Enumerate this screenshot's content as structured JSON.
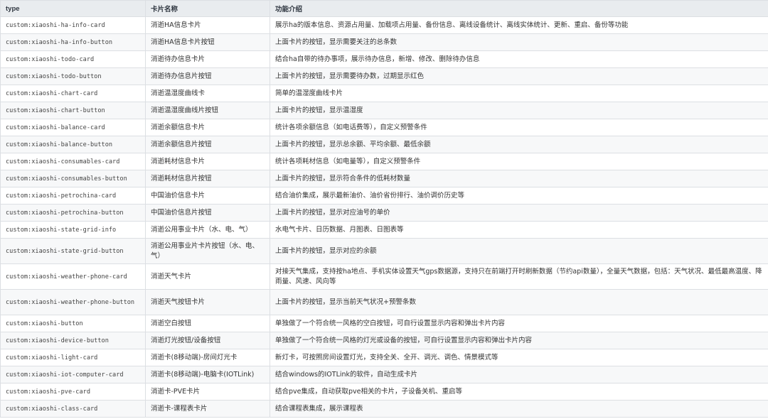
{
  "table": {
    "headers": [
      "type",
      "卡片名称",
      "功能介绍"
    ],
    "rows": [
      {
        "type": "custom:xiaoshi-ha-info-card",
        "name": "消逝HA信息卡片",
        "desc": "展示ha的版本信息、资源占用量、加载项占用量、备份信息、离线设备统计、离线实体统计、更新、重启、备份等功能"
      },
      {
        "type": "custom:xiaoshi-ha-info-button",
        "name": "消逝HA信息卡片按钮",
        "desc": "上面卡片的按钮，显示需要关注的总条数"
      },
      {
        "type": "custom:xiaoshi-todo-card",
        "name": "消逝待办信息卡片",
        "desc": "结合ha自带的待办事项，展示待办信息，新增、修改、删除待办信息"
      },
      {
        "type": "custom:xiaoshi-todo-button",
        "name": "消逝待办信息片按钮",
        "desc": "上面卡片的按钮，显示需要待办数，过期显示红色"
      },
      {
        "type": "custom:xiaoshi-chart-card",
        "name": "消逝温湿度曲线卡",
        "desc": "简单的温湿度曲线卡片"
      },
      {
        "type": "custom:xiaoshi-chart-button",
        "name": "消逝温湿度曲线片按钮",
        "desc": "上面卡片的按钮，显示温湿度"
      },
      {
        "type": "custom:xiaoshi-balance-card",
        "name": "消逝余额信息卡片",
        "desc": "统计各项余额信息（如电话费等），自定义预警条件"
      },
      {
        "type": "custom:xiaoshi-balance-button",
        "name": "消逝余额信息片按钮",
        "desc": "上面卡片的按钮，显示总余额、平均余额、最低余额"
      },
      {
        "type": "custom:xiaoshi-consumables-card",
        "name": "消逝耗材信息卡片",
        "desc": "统计各项耗材信息（如电量等），自定义预警条件"
      },
      {
        "type": "custom:xiaoshi-consumables-button",
        "name": "消逝耗材信息片按钮",
        "desc": "上面卡片的按钮，显示符合条件的低耗材数量"
      },
      {
        "type": "custom:xiaoshi-petrochina-card",
        "name": "中国油价信息卡片",
        "desc": "结合油价集成，展示最新油价、油价省份排行、油价调价历史等"
      },
      {
        "type": "custom:xiaoshi-petrochina-button",
        "name": "中国油价信息片按钮",
        "desc": "上面卡片的按钮，显示对应油号的单价"
      },
      {
        "type": "custom:xiaoshi-state-grid-info",
        "name": "消逝公用事业卡片（水、电、气）",
        "desc": "水电气卡片、日历数据、月图表、日图表等"
      },
      {
        "type": "custom:xiaoshi-state-grid-button",
        "name": "消逝公用事业片卡片按钮（水、电、气）",
        "desc": "上面卡片的按钮，显示对应的余额"
      },
      {
        "type": "custom:xiaoshi-weather-phone-card",
        "name": "消逝天气卡片",
        "desc": "对接天气集成，支持按ha地点、手机实体设置天气gps数据源，支持只在前端打开时刷新数据（节约api数量），全量天气数据，包括：天气状况、最低最高温度、降雨量、风速、风向等"
      },
      {
        "type": "custom:xiaoshi-weather-phone-button",
        "name": "消逝天气按钮卡片",
        "desc": "上面卡片的按钮，显示当前天气状况+预警条数"
      },
      {
        "type": "custom:xiaoshi-button",
        "name": "消逝空白按钮",
        "desc": "单独做了一个符合统一风格的空白按钮，可自行设置显示内容和弹出卡片内容"
      },
      {
        "type": "custom:xiaoshi-device-button",
        "name": "消逝灯光按钮/设备按钮",
        "desc": "单独做了一个符合统一风格的灯光或设备的按钮，可自行设置显示内容和弹出卡片内容"
      },
      {
        "type": "custom:xiaoshi-light-card",
        "name": "消逝卡(8移动端)-房间灯光卡",
        "desc": "新灯卡，可按照房间设置灯光，支持全关、全开、调光、调色、情景模式等"
      },
      {
        "type": "custom:xiaoshi-iot-computer-card",
        "name": "消逝卡(8移动端)-电脑卡(IOTLink)",
        "desc": "结合windows的IOTLink的软件，自动生成卡片"
      },
      {
        "type": "custom:xiaoshi-pve-card",
        "name": "消逝卡-PVE卡片",
        "desc": "结合pve集成，自动获取pve相关的卡片，子设备关机、重启等"
      },
      {
        "type": "custom:xiaoshi-class-card",
        "name": "消逝卡-课程表卡片",
        "desc": "结合课程表集成，展示课程表"
      }
    ]
  }
}
